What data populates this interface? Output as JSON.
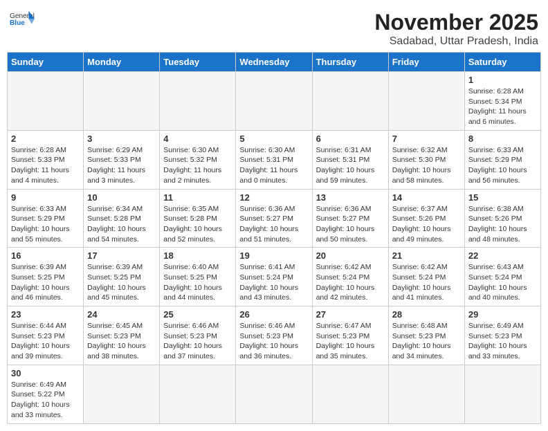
{
  "header": {
    "logo_general": "General",
    "logo_blue": "Blue",
    "month_year": "November 2025",
    "location": "Sadabad, Uttar Pradesh, India"
  },
  "weekdays": [
    "Sunday",
    "Monday",
    "Tuesday",
    "Wednesday",
    "Thursday",
    "Friday",
    "Saturday"
  ],
  "weeks": [
    [
      {
        "day": "",
        "info": ""
      },
      {
        "day": "",
        "info": ""
      },
      {
        "day": "",
        "info": ""
      },
      {
        "day": "",
        "info": ""
      },
      {
        "day": "",
        "info": ""
      },
      {
        "day": "",
        "info": ""
      },
      {
        "day": "1",
        "info": "Sunrise: 6:28 AM\nSunset: 5:34 PM\nDaylight: 11 hours and 6 minutes."
      }
    ],
    [
      {
        "day": "2",
        "info": "Sunrise: 6:28 AM\nSunset: 5:33 PM\nDaylight: 11 hours and 4 minutes."
      },
      {
        "day": "3",
        "info": "Sunrise: 6:29 AM\nSunset: 5:33 PM\nDaylight: 11 hours and 3 minutes."
      },
      {
        "day": "4",
        "info": "Sunrise: 6:30 AM\nSunset: 5:32 PM\nDaylight: 11 hours and 2 minutes."
      },
      {
        "day": "5",
        "info": "Sunrise: 6:30 AM\nSunset: 5:31 PM\nDaylight: 11 hours and 0 minutes."
      },
      {
        "day": "6",
        "info": "Sunrise: 6:31 AM\nSunset: 5:31 PM\nDaylight: 10 hours and 59 minutes."
      },
      {
        "day": "7",
        "info": "Sunrise: 6:32 AM\nSunset: 5:30 PM\nDaylight: 10 hours and 58 minutes."
      },
      {
        "day": "8",
        "info": "Sunrise: 6:33 AM\nSunset: 5:29 PM\nDaylight: 10 hours and 56 minutes."
      }
    ],
    [
      {
        "day": "9",
        "info": "Sunrise: 6:33 AM\nSunset: 5:29 PM\nDaylight: 10 hours and 55 minutes."
      },
      {
        "day": "10",
        "info": "Sunrise: 6:34 AM\nSunset: 5:28 PM\nDaylight: 10 hours and 54 minutes."
      },
      {
        "day": "11",
        "info": "Sunrise: 6:35 AM\nSunset: 5:28 PM\nDaylight: 10 hours and 52 minutes."
      },
      {
        "day": "12",
        "info": "Sunrise: 6:36 AM\nSunset: 5:27 PM\nDaylight: 10 hours and 51 minutes."
      },
      {
        "day": "13",
        "info": "Sunrise: 6:36 AM\nSunset: 5:27 PM\nDaylight: 10 hours and 50 minutes."
      },
      {
        "day": "14",
        "info": "Sunrise: 6:37 AM\nSunset: 5:26 PM\nDaylight: 10 hours and 49 minutes."
      },
      {
        "day": "15",
        "info": "Sunrise: 6:38 AM\nSunset: 5:26 PM\nDaylight: 10 hours and 48 minutes."
      }
    ],
    [
      {
        "day": "16",
        "info": "Sunrise: 6:39 AM\nSunset: 5:25 PM\nDaylight: 10 hours and 46 minutes."
      },
      {
        "day": "17",
        "info": "Sunrise: 6:39 AM\nSunset: 5:25 PM\nDaylight: 10 hours and 45 minutes."
      },
      {
        "day": "18",
        "info": "Sunrise: 6:40 AM\nSunset: 5:25 PM\nDaylight: 10 hours and 44 minutes."
      },
      {
        "day": "19",
        "info": "Sunrise: 6:41 AM\nSunset: 5:24 PM\nDaylight: 10 hours and 43 minutes."
      },
      {
        "day": "20",
        "info": "Sunrise: 6:42 AM\nSunset: 5:24 PM\nDaylight: 10 hours and 42 minutes."
      },
      {
        "day": "21",
        "info": "Sunrise: 6:42 AM\nSunset: 5:24 PM\nDaylight: 10 hours and 41 minutes."
      },
      {
        "day": "22",
        "info": "Sunrise: 6:43 AM\nSunset: 5:24 PM\nDaylight: 10 hours and 40 minutes."
      }
    ],
    [
      {
        "day": "23",
        "info": "Sunrise: 6:44 AM\nSunset: 5:23 PM\nDaylight: 10 hours and 39 minutes."
      },
      {
        "day": "24",
        "info": "Sunrise: 6:45 AM\nSunset: 5:23 PM\nDaylight: 10 hours and 38 minutes."
      },
      {
        "day": "25",
        "info": "Sunrise: 6:46 AM\nSunset: 5:23 PM\nDaylight: 10 hours and 37 minutes."
      },
      {
        "day": "26",
        "info": "Sunrise: 6:46 AM\nSunset: 5:23 PM\nDaylight: 10 hours and 36 minutes."
      },
      {
        "day": "27",
        "info": "Sunrise: 6:47 AM\nSunset: 5:23 PM\nDaylight: 10 hours and 35 minutes."
      },
      {
        "day": "28",
        "info": "Sunrise: 6:48 AM\nSunset: 5:23 PM\nDaylight: 10 hours and 34 minutes."
      },
      {
        "day": "29",
        "info": "Sunrise: 6:49 AM\nSunset: 5:23 PM\nDaylight: 10 hours and 33 minutes."
      }
    ],
    [
      {
        "day": "30",
        "info": "Sunrise: 6:49 AM\nSunset: 5:22 PM\nDaylight: 10 hours and 33 minutes."
      },
      {
        "day": "",
        "info": ""
      },
      {
        "day": "",
        "info": ""
      },
      {
        "day": "",
        "info": ""
      },
      {
        "day": "",
        "info": ""
      },
      {
        "day": "",
        "info": ""
      },
      {
        "day": "",
        "info": ""
      }
    ]
  ]
}
